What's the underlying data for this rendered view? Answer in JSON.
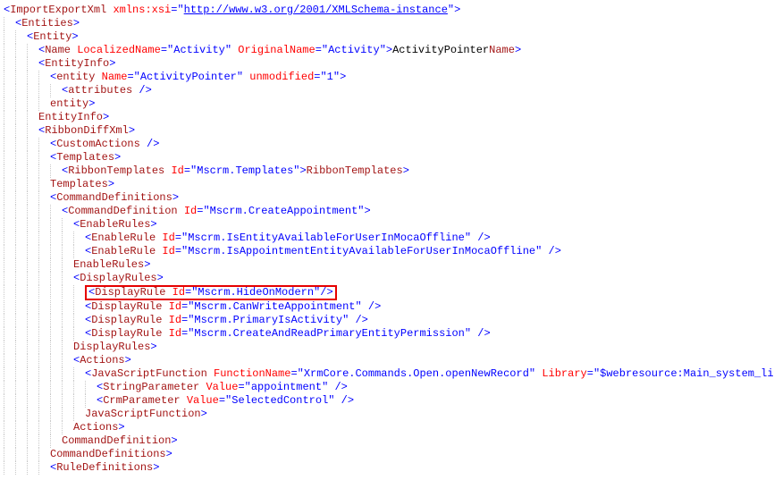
{
  "lines": [
    {
      "i": 0,
      "parts": [
        [
          "b",
          "<"
        ],
        [
          "t",
          "ImportExportXml"
        ],
        [
          "p",
          " "
        ],
        [
          "a",
          "xmlns:xsi"
        ],
        [
          "e",
          "="
        ],
        [
          "q",
          "\""
        ],
        [
          "l",
          "http://www.w3.org/2001/XMLSchema-instance"
        ],
        [
          "q",
          "\""
        ],
        [
          "b",
          ">"
        ]
      ]
    },
    {
      "i": 1,
      "parts": [
        [
          "b",
          "<"
        ],
        [
          "t",
          "Entities"
        ],
        [
          "b",
          ">"
        ]
      ]
    },
    {
      "i": 2,
      "parts": [
        [
          "b",
          "<"
        ],
        [
          "t",
          "Entity"
        ],
        [
          "b",
          ">"
        ]
      ]
    },
    {
      "i": 3,
      "parts": [
        [
          "b",
          "<"
        ],
        [
          "t",
          "Name"
        ],
        [
          "p",
          " "
        ],
        [
          "a",
          "LocalizedName"
        ],
        [
          "e",
          "="
        ],
        [
          "v",
          "\"Activity\""
        ],
        [
          "p",
          " "
        ],
        [
          "a",
          "OriginalName"
        ],
        [
          "e",
          "="
        ],
        [
          "v",
          "\"Activity\""
        ],
        [
          "b",
          ">"
        ],
        [
          "x",
          "ActivityPointer"
        ],
        [
          "b",
          "</"
        ],
        [
          "t",
          "Name"
        ],
        [
          "b",
          ">"
        ]
      ]
    },
    {
      "i": 3,
      "parts": [
        [
          "b",
          "<"
        ],
        [
          "t",
          "EntityInfo"
        ],
        [
          "b",
          ">"
        ]
      ]
    },
    {
      "i": 4,
      "parts": [
        [
          "b",
          "<"
        ],
        [
          "t",
          "entity"
        ],
        [
          "p",
          " "
        ],
        [
          "a",
          "Name"
        ],
        [
          "e",
          "="
        ],
        [
          "v",
          "\"ActivityPointer\""
        ],
        [
          "p",
          " "
        ],
        [
          "a",
          "unmodified"
        ],
        [
          "e",
          "="
        ],
        [
          "v",
          "\"1\""
        ],
        [
          "b",
          ">"
        ]
      ]
    },
    {
      "i": 5,
      "parts": [
        [
          "b",
          "<"
        ],
        [
          "t",
          "attributes"
        ],
        [
          "b",
          " />"
        ]
      ]
    },
    {
      "i": 4,
      "parts": [
        [
          "b",
          "</"
        ],
        [
          "t",
          "entity"
        ],
        [
          "b",
          ">"
        ]
      ]
    },
    {
      "i": 3,
      "parts": [
        [
          "b",
          "</"
        ],
        [
          "t",
          "EntityInfo"
        ],
        [
          "b",
          ">"
        ]
      ]
    },
    {
      "i": 3,
      "parts": [
        [
          "b",
          "<"
        ],
        [
          "t",
          "RibbonDiffXml"
        ],
        [
          "b",
          ">"
        ]
      ]
    },
    {
      "i": 4,
      "parts": [
        [
          "b",
          "<"
        ],
        [
          "t",
          "CustomActions"
        ],
        [
          "b",
          " />"
        ]
      ]
    },
    {
      "i": 4,
      "parts": [
        [
          "b",
          "<"
        ],
        [
          "t",
          "Templates"
        ],
        [
          "b",
          ">"
        ]
      ]
    },
    {
      "i": 5,
      "parts": [
        [
          "b",
          "<"
        ],
        [
          "t",
          "RibbonTemplates"
        ],
        [
          "p",
          " "
        ],
        [
          "a",
          "Id"
        ],
        [
          "e",
          "="
        ],
        [
          "v",
          "\"Mscrm.Templates\""
        ],
        [
          "b",
          ">"
        ],
        [
          "b",
          "</"
        ],
        [
          "t",
          "RibbonTemplates"
        ],
        [
          "b",
          ">"
        ]
      ]
    },
    {
      "i": 4,
      "parts": [
        [
          "b",
          "</"
        ],
        [
          "t",
          "Templates"
        ],
        [
          "b",
          ">"
        ]
      ]
    },
    {
      "i": 4,
      "parts": [
        [
          "b",
          "<"
        ],
        [
          "t",
          "CommandDefinitions"
        ],
        [
          "b",
          ">"
        ]
      ]
    },
    {
      "i": 5,
      "parts": [
        [
          "b",
          "<"
        ],
        [
          "t",
          "CommandDefinition"
        ],
        [
          "p",
          " "
        ],
        [
          "a",
          "Id"
        ],
        [
          "e",
          "="
        ],
        [
          "v",
          "\"Mscrm.CreateAppointment\""
        ],
        [
          "b",
          ">"
        ]
      ]
    },
    {
      "i": 6,
      "parts": [
        [
          "b",
          "<"
        ],
        [
          "t",
          "EnableRules"
        ],
        [
          "b",
          ">"
        ]
      ]
    },
    {
      "i": 7,
      "parts": [
        [
          "b",
          "<"
        ],
        [
          "t",
          "EnableRule"
        ],
        [
          "p",
          " "
        ],
        [
          "a",
          "Id"
        ],
        [
          "e",
          "="
        ],
        [
          "v",
          "\"Mscrm.IsEntityAvailableForUserInMocaOffline\""
        ],
        [
          "b",
          " />"
        ]
      ]
    },
    {
      "i": 7,
      "parts": [
        [
          "b",
          "<"
        ],
        [
          "t",
          "EnableRule"
        ],
        [
          "p",
          " "
        ],
        [
          "a",
          "Id"
        ],
        [
          "e",
          "="
        ],
        [
          "v",
          "\"Mscrm.IsAppointmentEntityAvailableForUserInMocaOffline\""
        ],
        [
          "b",
          " />"
        ]
      ]
    },
    {
      "i": 6,
      "parts": [
        [
          "b",
          "</"
        ],
        [
          "t",
          "EnableRules"
        ],
        [
          "b",
          ">"
        ]
      ]
    },
    {
      "i": 6,
      "parts": [
        [
          "b",
          "<"
        ],
        [
          "t",
          "DisplayRules"
        ],
        [
          "b",
          ">"
        ]
      ]
    },
    {
      "i": 7,
      "hl": true,
      "parts": [
        [
          "b",
          "<"
        ],
        [
          "t",
          "DisplayRule"
        ],
        [
          "p",
          " "
        ],
        [
          "a",
          "Id"
        ],
        [
          "e",
          "="
        ],
        [
          "v",
          "\"Mscrm.HideOnModern\""
        ],
        [
          "b",
          "/>"
        ]
      ]
    },
    {
      "i": 7,
      "parts": [
        [
          "b",
          "<"
        ],
        [
          "t",
          "DisplayRule"
        ],
        [
          "p",
          " "
        ],
        [
          "a",
          "Id"
        ],
        [
          "e",
          "="
        ],
        [
          "v",
          "\"Mscrm.CanWriteAppointment\""
        ],
        [
          "b",
          " />"
        ]
      ]
    },
    {
      "i": 7,
      "parts": [
        [
          "b",
          "<"
        ],
        [
          "t",
          "DisplayRule"
        ],
        [
          "p",
          " "
        ],
        [
          "a",
          "Id"
        ],
        [
          "e",
          "="
        ],
        [
          "v",
          "\"Mscrm.PrimaryIsActivity\""
        ],
        [
          "b",
          " />"
        ]
      ]
    },
    {
      "i": 7,
      "parts": [
        [
          "b",
          "<"
        ],
        [
          "t",
          "DisplayRule"
        ],
        [
          "p",
          " "
        ],
        [
          "a",
          "Id"
        ],
        [
          "e",
          "="
        ],
        [
          "v",
          "\"Mscrm.CreateAndReadPrimaryEntityPermission\""
        ],
        [
          "b",
          " />"
        ]
      ]
    },
    {
      "i": 6,
      "parts": [
        [
          "b",
          "</"
        ],
        [
          "t",
          "DisplayRules"
        ],
        [
          "b",
          ">"
        ]
      ]
    },
    {
      "i": 6,
      "parts": [
        [
          "b",
          "<"
        ],
        [
          "t",
          "Actions"
        ],
        [
          "b",
          ">"
        ]
      ]
    },
    {
      "i": 7,
      "parts": [
        [
          "b",
          "<"
        ],
        [
          "t",
          "JavaScriptFunction"
        ],
        [
          "p",
          " "
        ],
        [
          "a",
          "FunctionName"
        ],
        [
          "e",
          "="
        ],
        [
          "v",
          "\"XrmCore.Commands.Open.openNewRecord\""
        ],
        [
          "p",
          " "
        ],
        [
          "a",
          "Library"
        ],
        [
          "e",
          "="
        ],
        [
          "v",
          "\"$webresource:Main_system_library.js\""
        ],
        [
          "b",
          ">"
        ]
      ]
    },
    {
      "i": 8,
      "parts": [
        [
          "b",
          "<"
        ],
        [
          "t",
          "StringParameter"
        ],
        [
          "p",
          " "
        ],
        [
          "a",
          "Value"
        ],
        [
          "e",
          "="
        ],
        [
          "v",
          "\"appointment\""
        ],
        [
          "b",
          " />"
        ]
      ]
    },
    {
      "i": 8,
      "parts": [
        [
          "b",
          "<"
        ],
        [
          "t",
          "CrmParameter"
        ],
        [
          "p",
          " "
        ],
        [
          "a",
          "Value"
        ],
        [
          "e",
          "="
        ],
        [
          "v",
          "\"SelectedControl\""
        ],
        [
          "b",
          " />"
        ]
      ]
    },
    {
      "i": 7,
      "parts": [
        [
          "b",
          "</"
        ],
        [
          "t",
          "JavaScriptFunction"
        ],
        [
          "b",
          ">"
        ]
      ]
    },
    {
      "i": 6,
      "parts": [
        [
          "b",
          "</"
        ],
        [
          "t",
          "Actions"
        ],
        [
          "b",
          ">"
        ]
      ]
    },
    {
      "i": 5,
      "parts": [
        [
          "b",
          "</"
        ],
        [
          "t",
          "CommandDefinition"
        ],
        [
          "b",
          ">"
        ]
      ]
    },
    {
      "i": 4,
      "parts": [
        [
          "b",
          "</"
        ],
        [
          "t",
          "CommandDefinitions"
        ],
        [
          "b",
          ">"
        ]
      ]
    },
    {
      "i": 4,
      "parts": [
        [
          "b",
          "<"
        ],
        [
          "t",
          "RuleDefinitions"
        ],
        [
          "b",
          ">"
        ]
      ]
    }
  ]
}
